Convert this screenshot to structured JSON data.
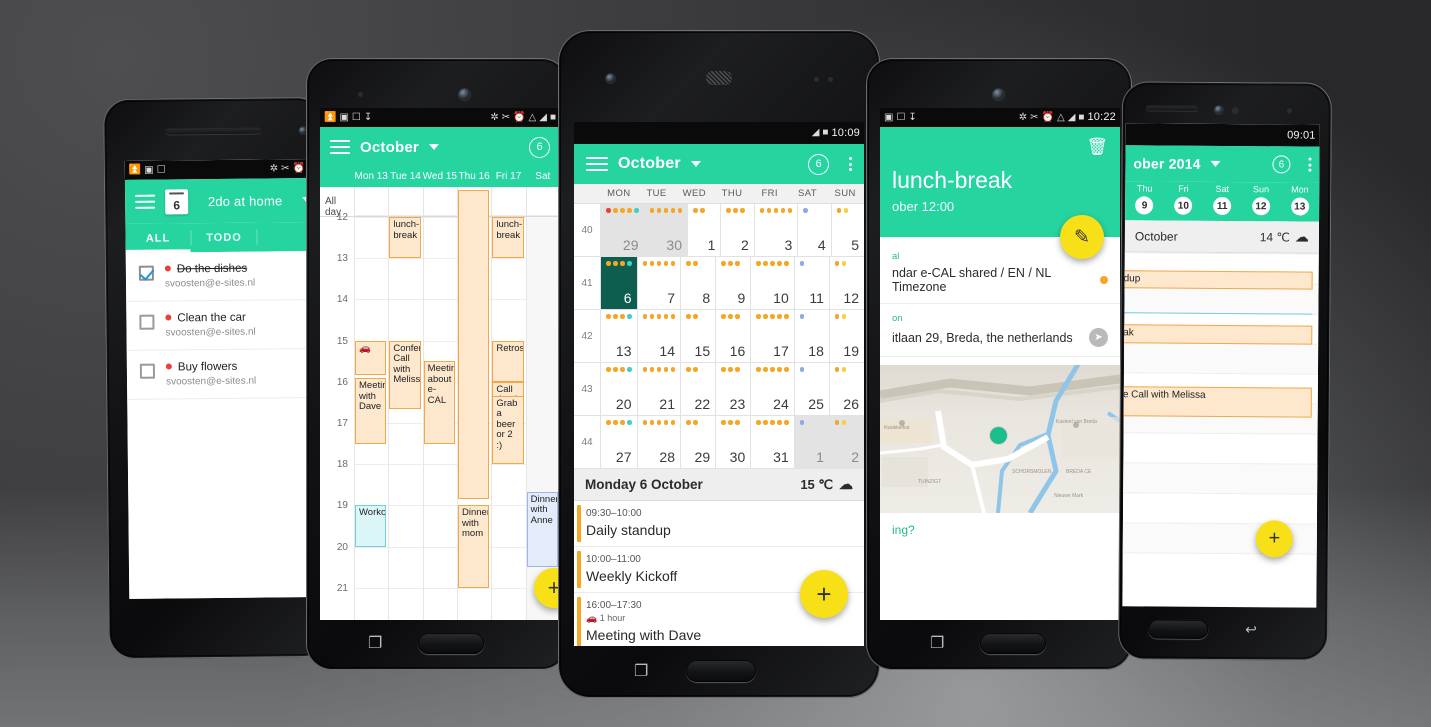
{
  "scene": {
    "title": "e-CAL calendar app — five Android phone mockups",
    "background_colors": {
      "dark": "#3a3a3c",
      "light": "#6e7072"
    },
    "accent_teal": "#26d4a0",
    "accent_yellow": "#f7e017",
    "event_orange": "#f5a623",
    "event_fill": "#fde7cd"
  },
  "phone1": {
    "statusbar": {
      "icons": [
        "usb-icon",
        "image-icon",
        "phone-check-icon"
      ],
      "right_icons": [
        "bluetooth-icon",
        "mute-icon",
        "alarm-icon",
        "wifi-icon"
      ],
      "time": ""
    },
    "appbar": {
      "date_badge": "6",
      "title": "2do at home",
      "caret": "▾"
    },
    "tabs": [
      {
        "label": "ALL",
        "selected": true
      },
      {
        "label": "TODO",
        "selected": false
      },
      {
        "label": "",
        "selected": false
      }
    ],
    "todos": [
      {
        "title": "Do the dishes",
        "account": "svoosten@e-sites.nl",
        "checked": true,
        "done": true
      },
      {
        "title": "Clean the car",
        "account": "svoosten@e-sites.nl",
        "checked": false,
        "done": false
      },
      {
        "title": "Buy flowers",
        "account": "svoosten@e-sites.nl",
        "checked": false,
        "done": false
      }
    ]
  },
  "phone2": {
    "statusbar": {
      "left_icons": [
        "usb-icon",
        "facebook-icon",
        "phone-check-icon",
        "download-icon"
      ],
      "right_icons": [
        "bluetooth-icon",
        "mute-icon",
        "alarm-icon",
        "wifi-icon",
        "signal-icon",
        "battery-icon"
      ],
      "time": ""
    },
    "appbar": {
      "title": "October",
      "caret": "▾",
      "badge": "6"
    },
    "day_headers": [
      "Mon 13",
      "Tue 14",
      "Wed 15",
      "Thu 16",
      "Fri 17",
      "Sat"
    ],
    "allday_label": "All day",
    "hours": [
      "12",
      "13",
      "14",
      "15",
      "16",
      "17",
      "18",
      "19",
      "20",
      "21"
    ],
    "events": [
      {
        "label": "lunch-break",
        "day": 1,
        "start": "12:00",
        "end": "13:00",
        "color": "orange"
      },
      {
        "label": "lunch-break",
        "day": 4,
        "start": "12:00",
        "end": "13:00",
        "color": "orange"
      },
      {
        "label": "",
        "day": 3,
        "start": "11:20",
        "end": "18:50",
        "color": "orange",
        "multiday": true
      },
      {
        "label": "🚗",
        "day": 0,
        "start": "15:00",
        "end": "15:50",
        "color": "orange"
      },
      {
        "label": "Meeting with Dave",
        "day": 0,
        "start": "15:55",
        "end": "17:30",
        "color": "orange"
      },
      {
        "label": "Conference Call with Meliss",
        "day": 1,
        "start": "15:00",
        "end": "16:40",
        "color": "orange"
      },
      {
        "label": "Meeting about e-CAL",
        "day": 2,
        "start": "15:30",
        "end": "17:30",
        "color": "orange"
      },
      {
        "label": "Retrospective",
        "day": 4,
        "start": "15:00",
        "end": "16:00",
        "color": "orange"
      },
      {
        "label": "Call dentist",
        "day": 4,
        "start": "16:00",
        "end": "16:35",
        "color": "orange"
      },
      {
        "label": "Grab a beer or 2 :)",
        "day": 4,
        "start": "16:20",
        "end": "18:00",
        "color": "orange"
      },
      {
        "label": "Workout",
        "day": 0,
        "start": "19:00",
        "end": "20:00",
        "color": "cyan"
      },
      {
        "label": "Dinner with mom",
        "day": 3,
        "start": "19:00",
        "end": "21:00",
        "color": "orange"
      },
      {
        "label": "Dinner with Anne",
        "day": 5,
        "start": "18:40",
        "end": "20:30",
        "color": "blue"
      }
    ]
  },
  "phone3": {
    "statusbar": {
      "right_icons": [
        "signal-icon",
        "battery-icon"
      ],
      "time": "10:09"
    },
    "appbar": {
      "title": "October",
      "caret": "▾",
      "badge": "6",
      "menu": "overflow-menu-icon"
    },
    "dow": [
      "MON",
      "TUE",
      "WED",
      "THU",
      "FRI",
      "SAT",
      "SUN"
    ],
    "weeks": [
      {
        "num": "40",
        "days": [
          {
            "n": "29",
            "dim": true,
            "dots": [
              "#e8413c",
              "#f5a623",
              "#f5a623",
              "#f5a623",
              "#3fd0c9"
            ]
          },
          {
            "n": "30",
            "dim": true,
            "dots": [
              "#f5a623",
              "#f5a623",
              "#f5a623",
              "#f5a623",
              "#f5a623"
            ]
          },
          {
            "n": "1",
            "dim": false,
            "dots": [
              "#f5a623",
              "#f5a623"
            ]
          },
          {
            "n": "2",
            "dim": false,
            "dots": [
              "#f5a623",
              "#f5a623",
              "#f5a623"
            ]
          },
          {
            "n": "3",
            "dim": false,
            "dots": [
              "#f5a623",
              "#f5a623",
              "#f5a623",
              "#f5a623",
              "#f5a623"
            ]
          },
          {
            "n": "4",
            "dim": false,
            "dots": [
              "#8fa8e8"
            ]
          },
          {
            "n": "5",
            "dim": false,
            "dots": [
              "#f5a623",
              "#f3d23f"
            ]
          }
        ]
      },
      {
        "num": "41",
        "days": [
          {
            "n": "6",
            "sel": true,
            "dots": [
              "#f5a623",
              "#f5a623",
              "#f5a623",
              "#3fd0c9"
            ]
          },
          {
            "n": "7",
            "dots": [
              "#f5a623",
              "#f5a623",
              "#f5a623",
              "#f5a623",
              "#f5a623"
            ]
          },
          {
            "n": "8",
            "dots": [
              "#f5a623",
              "#f5a623"
            ]
          },
          {
            "n": "9",
            "dots": [
              "#f5a623",
              "#f5a623",
              "#f5a623"
            ]
          },
          {
            "n": "10",
            "dots": [
              "#f5a623",
              "#f5a623",
              "#f5a623",
              "#f5a623",
              "#f5a623"
            ]
          },
          {
            "n": "11",
            "dots": [
              "#8fa8e8"
            ]
          },
          {
            "n": "12",
            "dots": [
              "#f5a623",
              "#f3d23f"
            ]
          }
        ]
      },
      {
        "num": "42",
        "days": [
          {
            "n": "13",
            "dots": [
              "#f5a623",
              "#f5a623",
              "#f5a623",
              "#3fd0c9"
            ]
          },
          {
            "n": "14",
            "dots": [
              "#f5a623",
              "#f5a623",
              "#f5a623",
              "#f5a623",
              "#f5a623"
            ]
          },
          {
            "n": "15",
            "dots": [
              "#f5a623",
              "#f5a623"
            ]
          },
          {
            "n": "16",
            "dots": [
              "#f5a623",
              "#f5a623",
              "#f5a623"
            ]
          },
          {
            "n": "17",
            "dots": [
              "#f5a623",
              "#f5a623",
              "#f5a623",
              "#f5a623",
              "#f5a623"
            ]
          },
          {
            "n": "18",
            "dots": [
              "#8fa8e8"
            ]
          },
          {
            "n": "19",
            "dots": [
              "#f5a623",
              "#f3d23f"
            ]
          }
        ]
      },
      {
        "num": "43",
        "days": [
          {
            "n": "20",
            "dots": [
              "#f5a623",
              "#f5a623",
              "#f5a623",
              "#3fd0c9"
            ]
          },
          {
            "n": "21",
            "dots": [
              "#f5a623",
              "#f5a623",
              "#f5a623",
              "#f5a623",
              "#f5a623"
            ]
          },
          {
            "n": "22",
            "dots": [
              "#f5a623",
              "#f5a623"
            ]
          },
          {
            "n": "23",
            "dots": [
              "#f5a623",
              "#f5a623",
              "#f5a623"
            ]
          },
          {
            "n": "24",
            "dots": [
              "#f5a623",
              "#f5a623",
              "#f5a623",
              "#f5a623",
              "#f5a623"
            ]
          },
          {
            "n": "25",
            "dots": [
              "#8fa8e8"
            ]
          },
          {
            "n": "26",
            "dots": [
              "#f5a623",
              "#f3d23f"
            ]
          }
        ]
      },
      {
        "num": "44",
        "days": [
          {
            "n": "27",
            "dots": [
              "#f5a623",
              "#f5a623",
              "#f5a623",
              "#3fd0c9"
            ]
          },
          {
            "n": "28",
            "dots": [
              "#f5a623",
              "#f5a623",
              "#f5a623",
              "#f5a623",
              "#f5a623"
            ]
          },
          {
            "n": "29",
            "dots": [
              "#f5a623",
              "#f5a623"
            ]
          },
          {
            "n": "30",
            "dots": [
              "#f5a623",
              "#f5a623",
              "#f5a623"
            ]
          },
          {
            "n": "31",
            "dots": [
              "#f5a623",
              "#f5a623",
              "#f5a623",
              "#f5a623",
              "#f5a623"
            ]
          },
          {
            "n": "1",
            "dim": true,
            "dots": [
              "#8fa8e8"
            ]
          },
          {
            "n": "2",
            "dim": true,
            "dots": [
              "#f5a623",
              "#f3d23f"
            ]
          }
        ]
      }
    ],
    "agenda_header": {
      "date": "Monday 6 October",
      "temp": "15 ℃",
      "weather_icon": "cloud-icon"
    },
    "agenda": [
      {
        "time": "09:30–10:00",
        "title": "Daily standup",
        "travel": ""
      },
      {
        "time": "10:00–11:00",
        "title": "Weekly Kickoff",
        "travel": ""
      },
      {
        "time": "16:00–17:30",
        "title": "Meeting with Dave",
        "travel": "1 hour",
        "travel_icon": "car-icon"
      }
    ],
    "fab": {
      "label": "+",
      "name": "add-event-fab"
    }
  },
  "phone4": {
    "statusbar": {
      "left_icons": [
        "image-icon",
        "phone-check-icon",
        "download-icon"
      ],
      "right_icons": [
        "bluetooth-icon",
        "mute-icon",
        "alarm-icon",
        "wifi-icon",
        "signal-icon",
        "battery-icon"
      ],
      "time": "10:22"
    },
    "header": {
      "title": "lunch-break",
      "subtitle": "ober 12:00",
      "delete_icon": "trash-icon",
      "edit_icon": "pencil-icon"
    },
    "rows": [
      {
        "caption": "al",
        "value": "ndar  e-CAL shared / EN / NL Timezone",
        "dot": "#f5a623"
      },
      {
        "caption": "on",
        "value": "itlaan 29, Breda, the netherlands",
        "action_icon": "navigate-icon"
      }
    ],
    "footer_link": "ing?"
  },
  "phone5": {
    "statusbar": {
      "time": "09:01"
    },
    "appbar": {
      "title": "ober 2014",
      "caret": "▾",
      "badge": "6",
      "menu": "overflow-menu-icon"
    },
    "days": [
      {
        "name": "Thu",
        "num": "9"
      },
      {
        "name": "Fri",
        "num": "10"
      },
      {
        "name": "Sat",
        "num": "11"
      },
      {
        "name": "Sun",
        "num": "12"
      },
      {
        "name": "Mon",
        "num": "13"
      }
    ],
    "dayheader": {
      "date": "October",
      "temp": "14 ℃",
      "weather_icon": "cloud-rain-icon"
    },
    "events": [
      {
        "label": "dup"
      },
      {
        "label": "ak"
      },
      {
        "label": "e Call with Melissa"
      }
    ],
    "fab": {
      "label": "+",
      "name": "add-event-fab"
    }
  }
}
